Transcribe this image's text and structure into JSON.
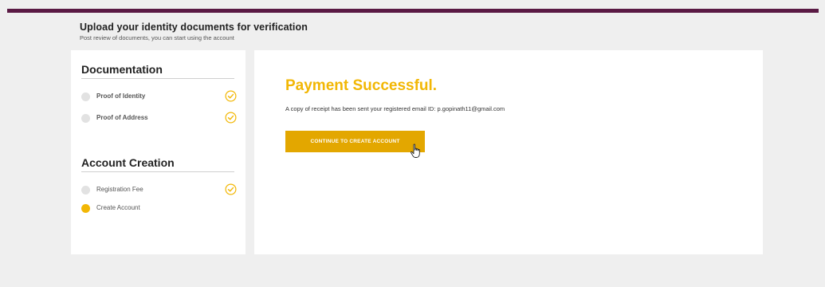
{
  "header": {
    "title": "Upload your identity documents for verification",
    "subtitle": "Post review of documents, you can start using the account"
  },
  "sidebar": {
    "documentation": {
      "title": "Documentation",
      "steps": [
        {
          "label": "Proof of Identity",
          "status": "complete"
        },
        {
          "label": "Proof of Address",
          "status": "complete"
        }
      ]
    },
    "account_creation": {
      "title": "Account Creation",
      "steps": [
        {
          "label": "Registration Fee",
          "status": "complete"
        },
        {
          "label": "Create Account",
          "status": "current"
        }
      ]
    }
  },
  "main": {
    "title": "Payment Successful.",
    "message": "A copy of receipt has been sent your registered email ID: p.gopinath11@gmail.com",
    "button_label": "CONTINUE TO CREATE ACCOUNT"
  },
  "colors": {
    "accent": "#f2b705",
    "button": "#e3a700",
    "top_bar": "#5a1a44",
    "background": "#efefef"
  }
}
